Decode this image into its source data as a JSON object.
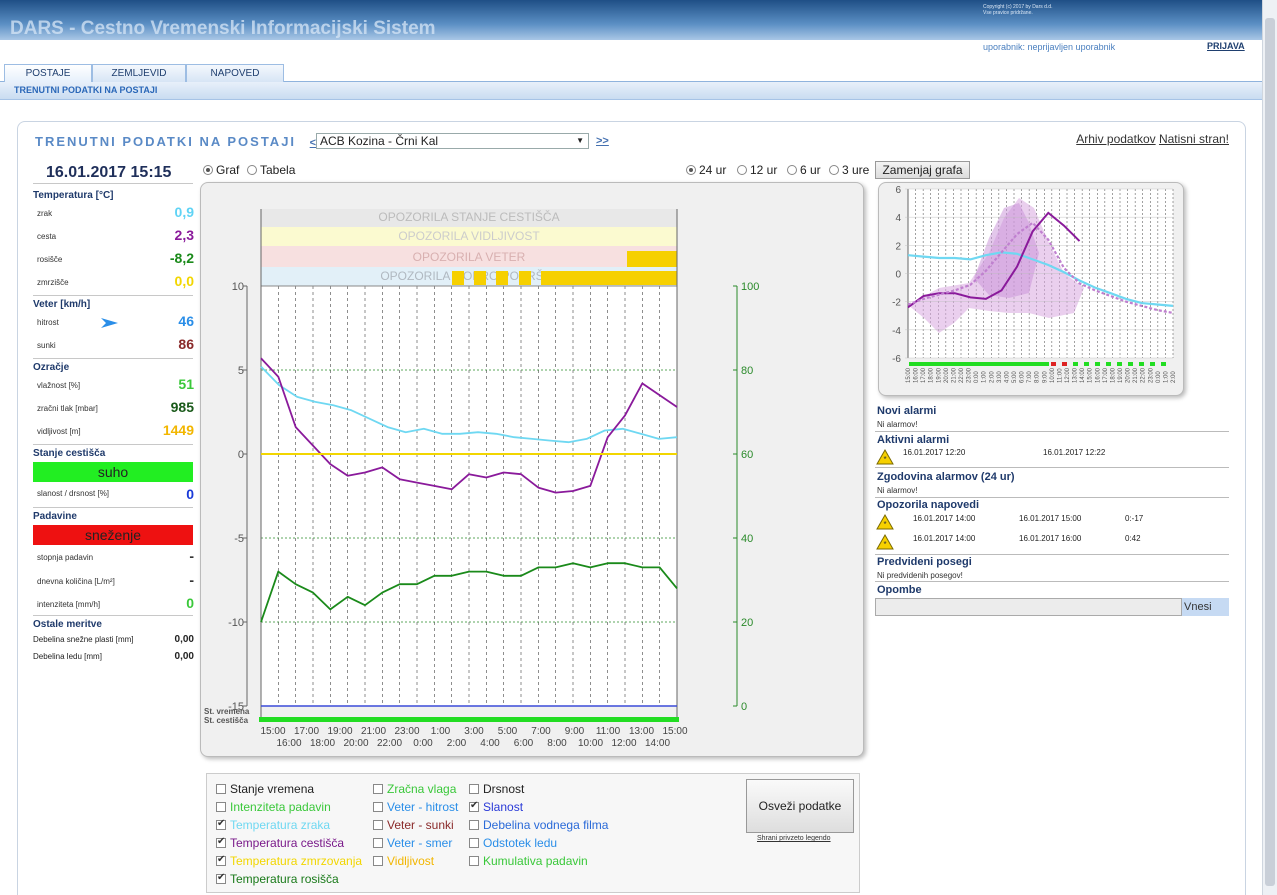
{
  "header": {
    "title": "DARS - Cestno Vremenski Informacijski Sistem",
    "copyright": "Copyright (c) 2017 by Dars d.d.",
    "rights": "Vse pravice pridržane.",
    "user_label": "uporabnik: neprijavljen uporabnik",
    "login": "PRIJAVA"
  },
  "tabs": [
    "POSTAJE",
    "ZEMLJEVID",
    "NAPOVED"
  ],
  "subnav": "TRENUTNI PODATKI NA POSTAJI",
  "page": {
    "title": "TRENUTNI PODATKI NA POSTAJI",
    "prev": "<<",
    "next": ">>",
    "station": "ACB Kozina - Črni Kal",
    "archive": "Arhiv podatkov",
    "print": "Natisni stran!"
  },
  "left": {
    "datetime": "16.01.2017 15:15",
    "temp_title": "Temperatura [°C]",
    "temp": [
      {
        "label": "zrak",
        "value": "0,9",
        "color": "#5fd3f5"
      },
      {
        "label": "cesta",
        "value": "2,3",
        "color": "#8a1a9b"
      },
      {
        "label": "rosišče",
        "value": "-8,2",
        "color": "#1a8a1a"
      },
      {
        "label": "zmrzišče",
        "value": "0,0",
        "color": "#f2d600"
      }
    ],
    "wind_title": "Veter [km/h]",
    "wind": [
      {
        "label": "hitrost",
        "value": "46",
        "color": "#2a8ee8"
      },
      {
        "label": "sunki",
        "value": "86",
        "color": "#8a2a2a"
      }
    ],
    "atm_title": "Ozračje",
    "atm": [
      {
        "label": "vlažnost [%]",
        "value": "51",
        "color": "#3ac83a"
      },
      {
        "label": "zračni tlak [mbar]",
        "value": "985",
        "color": "#1a5a1a"
      },
      {
        "label": "vidljivost [m]",
        "value": "1449",
        "color": "#f2b600"
      }
    ],
    "road_title": "Stanje cestišča",
    "road_state": "suho",
    "road_slip_label": "slanost / drsnost [%]",
    "road_slip_value": "0",
    "precip_title": "Padavine",
    "precip_state": "sneženje",
    "precip": [
      {
        "label": "stopnja padavin",
        "value": "-",
        "color": "#333"
      },
      {
        "label": "dnevna količina [L/m²]",
        "value": "-",
        "color": "#333"
      },
      {
        "label": "intenziteta [mm/h]",
        "value": "0",
        "color": "#3ac83a"
      }
    ],
    "other_title": "Ostale meritve",
    "other": [
      {
        "label": "Debelina snežne plasti [mm]",
        "value": "0,00"
      },
      {
        "label": "Debelina ledu [mm]",
        "value": "0,00"
      }
    ],
    "colors": {
      "ok": "#22ee22",
      "alert": "#ee1111",
      "wind_arrow": "#2a8ee8"
    }
  },
  "controls": {
    "graf": "Graf",
    "tabela": "Tabela",
    "ranges": [
      "24 ur",
      "12 ur",
      "6 ur",
      "3 ure"
    ],
    "swap": "Zamenjaj grafa"
  },
  "right": {
    "new_alarms": "Novi alarmi",
    "new_alarms_txt": "Ni alarmov!",
    "active_alarms": "Aktivni alarmi",
    "active": [
      {
        "from": "16.01.2017 12:20",
        "to": "16.01.2017 12:22"
      }
    ],
    "history": "Zgodovina alarmov (24 ur)",
    "history_txt": "Ni alarmov!",
    "forecast": "Opozorila napovedi",
    "forecasts": [
      {
        "from": "16.01.2017 14:00",
        "to": "16.01.2017 15:00",
        "val": "0:-17"
      },
      {
        "from": "16.01.2017 14:00",
        "to": "16.01.2017 16:00",
        "val": "0:42"
      }
    ],
    "planned": "Predvideni posegi",
    "planned_txt": "Ni predvidenih posegov!",
    "notes": "Opombe",
    "enter": "Vnesi"
  },
  "legend": {
    "col1": [
      {
        "label": "Stanje vremena",
        "checked": false,
        "color": "#222"
      },
      {
        "label": "Intenziteta padavin",
        "checked": false,
        "color": "#3ac83a"
      },
      {
        "label": "Temperatura zraka",
        "checked": true,
        "color": "#6fd8f2"
      },
      {
        "label": "Temperatura cestišča",
        "checked": true,
        "color": "#7a1a8a"
      },
      {
        "label": "Temperatura zmrzovanja",
        "checked": true,
        "color": "#f2d600"
      },
      {
        "label": "Temperatura rosišča",
        "checked": true,
        "color": "#1a7a1a"
      }
    ],
    "col2": [
      {
        "label": "Zračna vlaga",
        "checked": false,
        "color": "#3ac83a"
      },
      {
        "label": "Veter - hitrost",
        "checked": false,
        "color": "#2a8ee8"
      },
      {
        "label": "Veter - sunki",
        "checked": false,
        "color": "#8a2a2a"
      },
      {
        "label": "Veter - smer",
        "checked": false,
        "color": "#2a8ee8"
      },
      {
        "label": "Vidljivost",
        "checked": false,
        "color": "#f2b600"
      }
    ],
    "col3": [
      {
        "label": "Drsnost",
        "checked": false,
        "color": "#222"
      },
      {
        "label": "Slanost",
        "checked": true,
        "color": "#2a3ad8"
      },
      {
        "label": "Debelina vodnega filma",
        "checked": false,
        "color": "#2a6ad8"
      },
      {
        "label": "Odstotek ledu",
        "checked": false,
        "color": "#2a8ee8"
      },
      {
        "label": "Kumulativa padavin",
        "checked": false,
        "color": "#3ac83a"
      }
    ],
    "refresh": "Osveži podatke",
    "save": "Shrani privzeto legendo"
  },
  "chart_data": [
    {
      "type": "line",
      "title": "",
      "bands": [
        "OPOZORILA STANJE CESTIŠČA",
        "OPOZORILA VIDLJIVOST",
        "OPOZORILA VETER",
        "OPOZORILA MOKRO POVRŠJE"
      ],
      "band_colors": [
        "#e8e8e8",
        "#fbfad0",
        "#f7e0e0",
        "#e2f0f8"
      ],
      "side_labels": [
        "St. vremena",
        "St. cestišča"
      ],
      "x_ticks_top": [
        "15:00",
        "17:00",
        "19:00",
        "21:00",
        "23:00",
        "1:00",
        "3:00",
        "5:00",
        "7:00",
        "9:00",
        "11:00",
        "13:00",
        "15:00"
      ],
      "x_ticks_bottom": [
        "16:00",
        "18:00",
        "20:00",
        "22:00",
        "0:00",
        "2:00",
        "4:00",
        "6:00",
        "8:00",
        "10:00",
        "12:00",
        "14:00"
      ],
      "y_left": [
        "10",
        "5",
        "0",
        "-5",
        "-10",
        "-15"
      ],
      "y_left_range": [
        -15,
        10
      ],
      "y_right": [
        "100",
        "80",
        "60",
        "40",
        "20",
        "0"
      ],
      "y_right_range": [
        0,
        100
      ],
      "series": [
        {
          "color": "#6fd8f2",
          "values": [
            5.2,
            4.1,
            3.4,
            3.1,
            2.9,
            2.6,
            2.1,
            1.6,
            1.3,
            1.5,
            1.2,
            1.2,
            1.3,
            1.2,
            1.0,
            0.9,
            0.8,
            0.7,
            0.9,
            1.4,
            1.5,
            1.2,
            0.9,
            1.0
          ]
        },
        {
          "color": "#8a1a9b",
          "values": [
            5.7,
            4.6,
            1.6,
            0.5,
            -0.6,
            -1.3,
            -1.1,
            -0.8,
            -1.5,
            -1.7,
            -1.9,
            -2.1,
            -1.2,
            -1.4,
            -1.1,
            -1.2,
            -2.0,
            -2.3,
            -2.2,
            -1.9,
            1.0,
            2.3,
            4.2,
            3.5,
            2.8
          ]
        },
        {
          "color": "#f2d600",
          "values": [
            0,
            0,
            0,
            0,
            0,
            0,
            0,
            0,
            0,
            0,
            0,
            0,
            0,
            0,
            0,
            0,
            0,
            0,
            0,
            0,
            0,
            0,
            0,
            0,
            0
          ]
        },
        {
          "color": "#1a8a1a",
          "axis": "right",
          "values": [
            20,
            32,
            29,
            27,
            23,
            26,
            24,
            27,
            29,
            29,
            31,
            31,
            32,
            32,
            31,
            31,
            33,
            33,
            34,
            33,
            34,
            34,
            33,
            33,
            28
          ]
        }
      ]
    },
    {
      "type": "line",
      "title": "",
      "y_ticks": [
        "6",
        "4",
        "2",
        "0",
        "-2",
        "-4",
        "-6"
      ],
      "y_range": [
        -6,
        6
      ],
      "x_ticks": [
        "15:00",
        "16:00",
        "17:00",
        "18:00",
        "19:00",
        "20:00",
        "21:00",
        "22:00",
        "23:00",
        "0:00",
        "1:00",
        "2:00",
        "3:00",
        "4:00",
        "5:00",
        "6:00",
        "7:00",
        "8:00",
        "9:00",
        "10:00",
        "11:00",
        "12:00",
        "13:00",
        "14:00",
        "15:00",
        "16:00",
        "17:00",
        "18:00",
        "19:00",
        "20:00",
        "21:00",
        "22:00",
        "23:00",
        "0:00",
        "1:00",
        "2:00"
      ],
      "series": [
        {
          "color": "#6fd8f2",
          "values": [
            1.3,
            1.2,
            1.1,
            1.1,
            1.0,
            1.3,
            1.5,
            1.4,
            1.0,
            0.6,
            0.1,
            -0.5,
            -1.0,
            -1.4,
            -1.8,
            -2.1,
            -2.2,
            -2.3
          ]
        },
        {
          "color": "#8a1a9b",
          "values": [
            -2.4,
            -1.6,
            -1.4,
            -1.4,
            -1.7,
            -1.8,
            -1.2,
            0.5,
            3.0,
            4.3,
            3.4,
            2.3
          ]
        },
        {
          "color": "#c080d0",
          "values": [
            -2.2,
            -1.8,
            -1.5,
            -1.2,
            -0.8,
            0.2,
            1.5,
            2.8,
            3.6,
            2.4,
            0.4,
            -0.7,
            -1.2,
            -1.6,
            -2.0,
            -2.3,
            -2.6,
            -2.8
          ]
        }
      ]
    }
  ]
}
